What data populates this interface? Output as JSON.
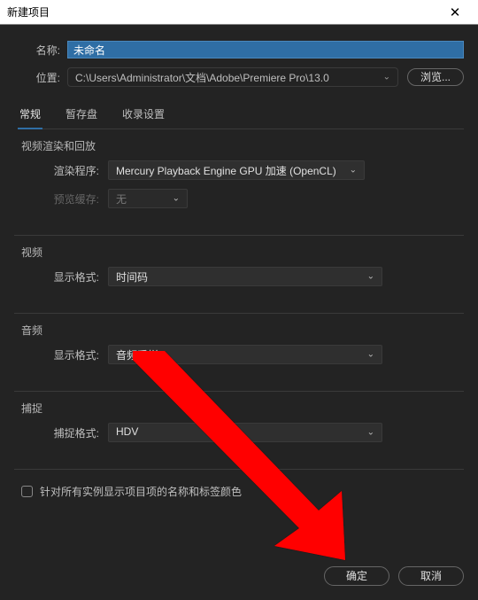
{
  "titlebar": {
    "title": "新建项目",
    "close": "✕"
  },
  "name_row": {
    "label": "名称:",
    "value": "未命名"
  },
  "location_row": {
    "label": "位置:",
    "value": "C:\\Users\\Administrator\\文档\\Adobe\\Premiere Pro\\13.0",
    "browse": "浏览..."
  },
  "tabs": [
    {
      "label": "常规",
      "active": true
    },
    {
      "label": "暂存盘",
      "active": false
    },
    {
      "label": "收录设置",
      "active": false
    }
  ],
  "sections": {
    "video_render": {
      "title": "视频渲染和回放",
      "renderer_label": "渲染程序:",
      "renderer_value": "Mercury Playback Engine GPU 加速 (OpenCL)",
      "cache_label": "预览缓存:",
      "cache_value": "无"
    },
    "video": {
      "title": "视频",
      "display_label": "显示格式:",
      "display_value": "时间码"
    },
    "audio": {
      "title": "音频",
      "display_label": "显示格式:",
      "display_value": "音频采样"
    },
    "capture": {
      "title": "捕捉",
      "format_label": "捕捉格式:",
      "format_value": "HDV"
    }
  },
  "checkbox": {
    "label": "针对所有实例显示项目项的名称和标签颜色"
  },
  "footer": {
    "ok": "确定",
    "cancel": "取消"
  },
  "colors": {
    "accent": "#2f6ea5",
    "arrow": "#ff0000"
  }
}
